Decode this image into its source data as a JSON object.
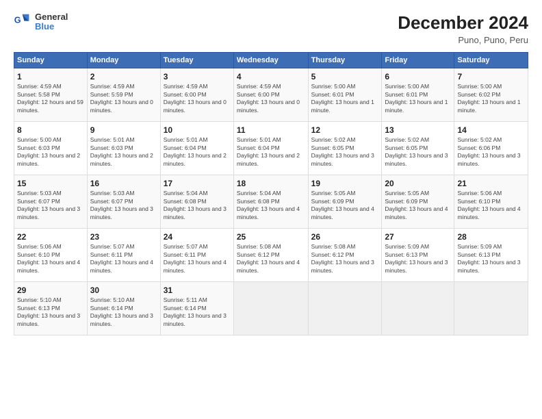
{
  "logo": {
    "line1": "General",
    "line2": "Blue"
  },
  "title": "December 2024",
  "subtitle": "Puno, Puno, Peru",
  "weekdays": [
    "Sunday",
    "Monday",
    "Tuesday",
    "Wednesday",
    "Thursday",
    "Friday",
    "Saturday"
  ],
  "weeks": [
    [
      {
        "day": "1",
        "info": "Sunrise: 4:59 AM\nSunset: 5:58 PM\nDaylight: 12 hours and 59 minutes."
      },
      {
        "day": "2",
        "info": "Sunrise: 4:59 AM\nSunset: 5:59 PM\nDaylight: 13 hours and 0 minutes."
      },
      {
        "day": "3",
        "info": "Sunrise: 4:59 AM\nSunset: 6:00 PM\nDaylight: 13 hours and 0 minutes."
      },
      {
        "day": "4",
        "info": "Sunrise: 4:59 AM\nSunset: 6:00 PM\nDaylight: 13 hours and 0 minutes."
      },
      {
        "day": "5",
        "info": "Sunrise: 5:00 AM\nSunset: 6:01 PM\nDaylight: 13 hours and 1 minute."
      },
      {
        "day": "6",
        "info": "Sunrise: 5:00 AM\nSunset: 6:01 PM\nDaylight: 13 hours and 1 minute."
      },
      {
        "day": "7",
        "info": "Sunrise: 5:00 AM\nSunset: 6:02 PM\nDaylight: 13 hours and 1 minute."
      }
    ],
    [
      {
        "day": "8",
        "info": "Sunrise: 5:00 AM\nSunset: 6:03 PM\nDaylight: 13 hours and 2 minutes."
      },
      {
        "day": "9",
        "info": "Sunrise: 5:01 AM\nSunset: 6:03 PM\nDaylight: 13 hours and 2 minutes."
      },
      {
        "day": "10",
        "info": "Sunrise: 5:01 AM\nSunset: 6:04 PM\nDaylight: 13 hours and 2 minutes."
      },
      {
        "day": "11",
        "info": "Sunrise: 5:01 AM\nSunset: 6:04 PM\nDaylight: 13 hours and 2 minutes."
      },
      {
        "day": "12",
        "info": "Sunrise: 5:02 AM\nSunset: 6:05 PM\nDaylight: 13 hours and 3 minutes."
      },
      {
        "day": "13",
        "info": "Sunrise: 5:02 AM\nSunset: 6:05 PM\nDaylight: 13 hours and 3 minutes."
      },
      {
        "day": "14",
        "info": "Sunrise: 5:02 AM\nSunset: 6:06 PM\nDaylight: 13 hours and 3 minutes."
      }
    ],
    [
      {
        "day": "15",
        "info": "Sunrise: 5:03 AM\nSunset: 6:07 PM\nDaylight: 13 hours and 3 minutes."
      },
      {
        "day": "16",
        "info": "Sunrise: 5:03 AM\nSunset: 6:07 PM\nDaylight: 13 hours and 3 minutes."
      },
      {
        "day": "17",
        "info": "Sunrise: 5:04 AM\nSunset: 6:08 PM\nDaylight: 13 hours and 3 minutes."
      },
      {
        "day": "18",
        "info": "Sunrise: 5:04 AM\nSunset: 6:08 PM\nDaylight: 13 hours and 4 minutes."
      },
      {
        "day": "19",
        "info": "Sunrise: 5:05 AM\nSunset: 6:09 PM\nDaylight: 13 hours and 4 minutes."
      },
      {
        "day": "20",
        "info": "Sunrise: 5:05 AM\nSunset: 6:09 PM\nDaylight: 13 hours and 4 minutes."
      },
      {
        "day": "21",
        "info": "Sunrise: 5:06 AM\nSunset: 6:10 PM\nDaylight: 13 hours and 4 minutes."
      }
    ],
    [
      {
        "day": "22",
        "info": "Sunrise: 5:06 AM\nSunset: 6:10 PM\nDaylight: 13 hours and 4 minutes."
      },
      {
        "day": "23",
        "info": "Sunrise: 5:07 AM\nSunset: 6:11 PM\nDaylight: 13 hours and 4 minutes."
      },
      {
        "day": "24",
        "info": "Sunrise: 5:07 AM\nSunset: 6:11 PM\nDaylight: 13 hours and 4 minutes."
      },
      {
        "day": "25",
        "info": "Sunrise: 5:08 AM\nSunset: 6:12 PM\nDaylight: 13 hours and 4 minutes."
      },
      {
        "day": "26",
        "info": "Sunrise: 5:08 AM\nSunset: 6:12 PM\nDaylight: 13 hours and 3 minutes."
      },
      {
        "day": "27",
        "info": "Sunrise: 5:09 AM\nSunset: 6:13 PM\nDaylight: 13 hours and 3 minutes."
      },
      {
        "day": "28",
        "info": "Sunrise: 5:09 AM\nSunset: 6:13 PM\nDaylight: 13 hours and 3 minutes."
      }
    ],
    [
      {
        "day": "29",
        "info": "Sunrise: 5:10 AM\nSunset: 6:13 PM\nDaylight: 13 hours and 3 minutes."
      },
      {
        "day": "30",
        "info": "Sunrise: 5:10 AM\nSunset: 6:14 PM\nDaylight: 13 hours and 3 minutes."
      },
      {
        "day": "31",
        "info": "Sunrise: 5:11 AM\nSunset: 6:14 PM\nDaylight: 13 hours and 3 minutes."
      },
      null,
      null,
      null,
      null
    ]
  ]
}
